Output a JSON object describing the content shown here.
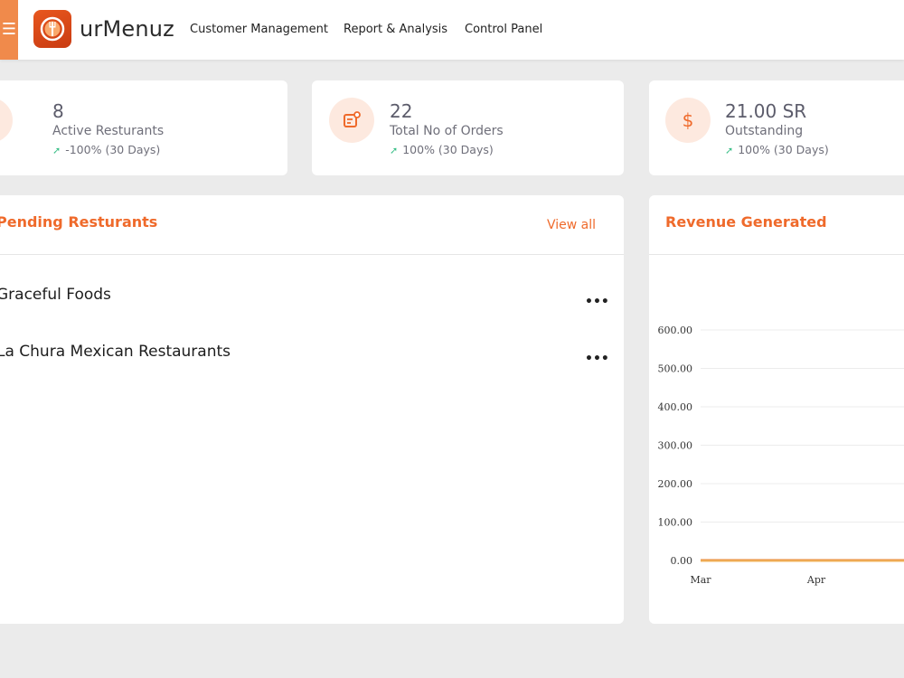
{
  "header": {
    "menu_glyph": "☰",
    "brand": "urMenuz",
    "nav": [
      "Customer Management",
      "Report & Analysis",
      "Control Panel"
    ]
  },
  "stats": [
    {
      "icon": "utensils-icon",
      "value": "8",
      "label": "Active Resturants",
      "change": "-100% (30 Days)"
    },
    {
      "icon": "orders-icon",
      "value": "22",
      "label": "Total No of Orders",
      "change": "100% (30 Days)"
    },
    {
      "icon": "dollar-icon",
      "value": "21.00 SR",
      "label": "Outstanding",
      "change": "100% (30 Days)"
    }
  ],
  "pending": {
    "title": "Pending Resturants",
    "view_all": "View all",
    "items": [
      {
        "name": "Graceful Foods",
        "menu": "•••"
      },
      {
        "name": "La Chura Mexican Restaurants",
        "menu": "•••"
      }
    ]
  },
  "revenue": {
    "title": "Revenue Generated"
  },
  "colors": {
    "accent": "#ef6a2b",
    "icon_bg": "#fde9df",
    "trend_up": "#3bbf88",
    "line": "#f0b35c"
  },
  "chart_data": {
    "type": "line",
    "title": "Revenue Generated",
    "x": [
      "Mar",
      "Apr"
    ],
    "series": [
      {
        "values": [
          0,
          0
        ]
      }
    ],
    "y_ticks": [
      "0.00",
      "100.00",
      "200.00",
      "300.00",
      "400.00",
      "500.00",
      "600.00"
    ],
    "ylim": [
      0,
      600
    ],
    "grid": true,
    "xlabel": "",
    "ylabel": ""
  }
}
